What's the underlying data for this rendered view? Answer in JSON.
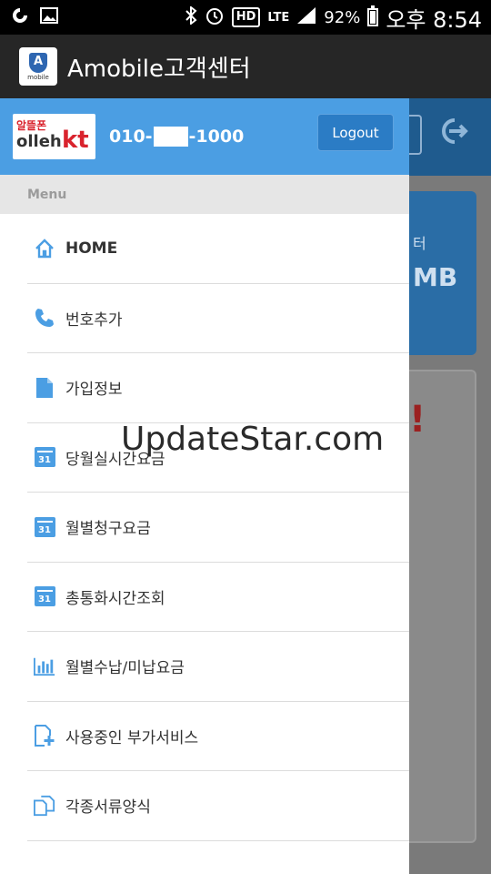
{
  "status_bar": {
    "battery": "92%",
    "time": "오후 8:54",
    "network": "LTE",
    "hd": "HD"
  },
  "app_bar": {
    "title": "Amobile고객센터",
    "logo_letter": "A",
    "logo_sub": "mobile"
  },
  "user": {
    "carrier_small": "알뜰폰",
    "carrier_main": "olleh",
    "carrier_kt": "kt",
    "phone_prefix": "010-",
    "phone_suffix": "-1000",
    "logout_label": "Logout"
  },
  "menu": {
    "header": "Menu",
    "items": [
      {
        "label": "HOME",
        "icon": "home-icon"
      },
      {
        "label": "번호추가",
        "icon": "phone-icon"
      },
      {
        "label": "가입정보",
        "icon": "document-icon"
      },
      {
        "label": "당월실시간요금",
        "icon": "calendar-icon"
      },
      {
        "label": "월별청구요금",
        "icon": "calendar-icon"
      },
      {
        "label": "총통화시간조회",
        "icon": "calendar-icon"
      },
      {
        "label": "월별수납/미납요금",
        "icon": "bar-chart-icon"
      },
      {
        "label": "사용중인 부가서비스",
        "icon": "add-document-icon"
      },
      {
        "label": "각종서류양식",
        "icon": "documents-icon"
      }
    ]
  },
  "background": {
    "card_text_1": "터",
    "card_text_2": "MB"
  },
  "watermark": "UpdateStar.com",
  "colors": {
    "drawer_header": "#4b9ee3",
    "logout_button": "#2b7cc5",
    "icon_blue": "#4b9ee3",
    "app_bar": "#262626"
  }
}
